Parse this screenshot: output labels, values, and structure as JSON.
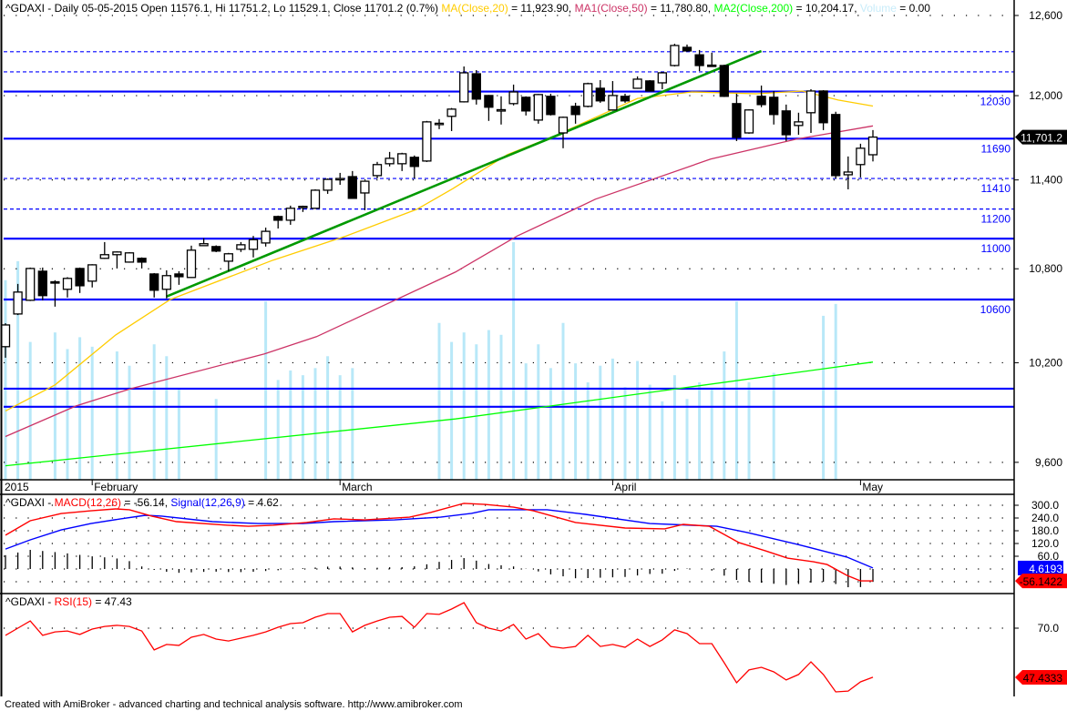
{
  "header": {
    "prefix": "^GDAXI - Daily 05-05-2015 Open 11576.1, Hi 11751.2, Lo 11529.1, Close 11701.2 (0.7%) ",
    "ma20_label": "MA(Close,20)",
    "ma20_value": " = 11,923.90, ",
    "ma50_label": "MA1(Close,50)",
    "ma50_value": " = 11,780.80, ",
    "ma200_label": "MA2(Close,200)",
    "ma200_value": " = 10,204.17, ",
    "volume_label": "Volume",
    "volume_value": " = 0.00"
  },
  "macd_header": {
    "prefix": "^GDAXI - ",
    "macd_label": "MACD(12,26)",
    "macd_value": " = -56.14, ",
    "signal_label": "Signal(12,26,9)",
    "signal_value": " = 4.62"
  },
  "rsi_header": {
    "prefix": "^GDAXI - ",
    "rsi_label": "RSI(15)",
    "rsi_value": " = 47.43"
  },
  "footer": "Created with AmiBroker - advanced charting and technical analysis software. http://www.amibroker.com",
  "colors": {
    "ma20": "#ffcc00",
    "ma50": "#cc3366",
    "ma200": "#00ff00",
    "volume": "#b8e8f8",
    "hline": "#0000ff",
    "trendline": "#009900",
    "macd": "#ff0000",
    "signal": "#0000ff",
    "rsi": "#ff0000"
  },
  "chart_data": [
    {
      "type": "candlestick",
      "title": "^GDAXI - Daily",
      "scale": "log",
      "ylim": [
        9600,
        12600
      ],
      "y_ticks": [
        {
          "v": 12600,
          "label": "12,600"
        },
        {
          "v": 12000,
          "label": "12,000"
        },
        {
          "v": 11400,
          "label": "11,400"
        },
        {
          "v": 10800,
          "label": "10,800"
        },
        {
          "v": 10200,
          "label": "10,200"
        },
        {
          "v": 9600,
          "label": "9,600"
        }
      ],
      "x_labels": [
        {
          "bar": 0,
          "label": "2015"
        },
        {
          "bar": 7,
          "label": "February"
        },
        {
          "bar": 27,
          "label": "March"
        },
        {
          "bar": 49,
          "label": "April"
        },
        {
          "bar": 69,
          "label": "May"
        }
      ],
      "last_price_label": "11,701.2",
      "ohlc": [
        [
          10300,
          10448,
          10231,
          10437
        ],
        [
          10507,
          10701,
          10500,
          10648
        ],
        [
          10595,
          10808,
          10590,
          10802
        ],
        [
          10784,
          10808,
          10595,
          10625
        ],
        [
          10715,
          10725,
          10554,
          10710
        ],
        [
          10666,
          10745,
          10613,
          10737
        ],
        [
          10802,
          10808,
          10642,
          10689
        ],
        [
          10719,
          10830,
          10678,
          10826
        ],
        [
          10869,
          10977,
          10865,
          10893
        ],
        [
          10893,
          10915,
          10802,
          10911
        ],
        [
          10844,
          10910,
          10840,
          10905
        ],
        [
          10869,
          10875,
          10802,
          10844
        ],
        [
          10766,
          10772,
          10613,
          10660
        ],
        [
          10666,
          10790,
          10607,
          10755
        ],
        [
          10766,
          10784,
          10695,
          10748
        ],
        [
          10743,
          10953,
          10740,
          10923
        ],
        [
          10953,
          11003,
          10950,
          10966
        ],
        [
          10947,
          10955,
          10910,
          10917
        ],
        [
          10850,
          10905,
          10784,
          10899
        ],
        [
          10929,
          10977,
          10911,
          10959
        ],
        [
          10929,
          11018,
          10875,
          10993
        ],
        [
          10971,
          11074,
          10947,
          11049
        ],
        [
          11149,
          11155,
          11068,
          11124
        ],
        [
          11124,
          11223,
          11093,
          11205
        ],
        [
          11212,
          11223,
          11180,
          11218
        ],
        [
          11205,
          11335,
          11200,
          11329
        ],
        [
          11329,
          11410,
          11304,
          11404
        ],
        [
          11404,
          11449,
          11366,
          11410
        ],
        [
          11423,
          11462,
          11270,
          11273
        ],
        [
          11310,
          11395,
          11192,
          11391
        ],
        [
          11430,
          11526,
          11410,
          11507
        ],
        [
          11513,
          11596,
          11494,
          11551
        ],
        [
          11513,
          11590,
          11462,
          11583
        ],
        [
          11558,
          11571,
          11410,
          11494
        ],
        [
          11532,
          11817,
          11525,
          11810
        ],
        [
          11795,
          11830,
          11758,
          11800
        ],
        [
          11850,
          11910,
          11744,
          11902
        ],
        [
          11955,
          12215,
          11950,
          12168
        ],
        [
          12161,
          12188,
          11935,
          11975
        ],
        [
          12001,
          12005,
          11817,
          11916
        ],
        [
          11890,
          11995,
          11791,
          11898
        ],
        [
          11942,
          12081,
          11929,
          12027
        ],
        [
          11988,
          11995,
          11856,
          11889
        ],
        [
          11823,
          12012,
          11797,
          12008
        ],
        [
          11995,
          12014,
          11856,
          11863
        ],
        [
          11731,
          11848,
          11622,
          11843
        ],
        [
          11922,
          11948,
          11797,
          11863
        ],
        [
          11922,
          12095,
          11915,
          12088
        ],
        [
          12054,
          12114,
          11948,
          11962
        ],
        [
          11896,
          12107,
          11890,
          12001
        ],
        [
          11995,
          12014,
          11948,
          11962
        ],
        [
          12054,
          12141,
          12050,
          12121
        ],
        [
          12108,
          12114,
          12030,
          12034
        ],
        [
          12094,
          12175,
          12047,
          12168
        ],
        [
          12222,
          12385,
          12215,
          12372
        ],
        [
          12358,
          12379,
          12325,
          12331
        ],
        [
          12302,
          12338,
          12181,
          12222
        ],
        [
          12225,
          12318,
          12218,
          12222
        ],
        [
          12222,
          12228,
          11990,
          11995
        ],
        [
          11942,
          12014,
          11673,
          11699
        ],
        [
          11731,
          11900,
          11725,
          11896
        ],
        [
          11995,
          12074,
          11916,
          11935
        ],
        [
          11988,
          12034,
          11791,
          11863
        ],
        [
          11889,
          11935,
          11673,
          11718
        ],
        [
          11784,
          11876,
          11718,
          11810
        ],
        [
          11876,
          12047,
          11731,
          12034
        ],
        [
          12034,
          12040,
          11751,
          11804
        ],
        [
          11863,
          11883,
          11410,
          11430
        ],
        [
          11436,
          11564,
          11335,
          11455
        ],
        [
          11507,
          11654,
          11417,
          11622
        ],
        [
          11576.1,
          11751.2,
          11529.1,
          11701.2
        ]
      ],
      "volume_relative": [
        84,
        92,
        58,
        null,
        62,
        55,
        60,
        56,
        null,
        54,
        48,
        null,
        57,
        52,
        38,
        null,
        null,
        34,
        null,
        null,
        null,
        75,
        42,
        46,
        44,
        47,
        52,
        44,
        47,
        null,
        null,
        null,
        null,
        null,
        null,
        66,
        58,
        62,
        57,
        63,
        61,
        100,
        49,
        57,
        47,
        66,
        49,
        41,
        48,
        51,
        39,
        50,
        40,
        33,
        44,
        34,
        41,
        38,
        54,
        75,
        41,
        null,
        45,
        null,
        null,
        null,
        69,
        74,
        null,
        null,
        null
      ],
      "ma20": [
        [
          0,
          9905
        ],
        [
          4,
          10063
        ],
        [
          8.9,
          10374
        ],
        [
          13.3,
          10600
        ],
        [
          21.6,
          10857
        ],
        [
          27.5,
          11018
        ],
        [
          33.2,
          11198
        ],
        [
          36.1,
          11340
        ],
        [
          40.5,
          11577
        ],
        [
          44.2,
          11705
        ],
        [
          51,
          11980
        ],
        [
          55.4,
          12027
        ],
        [
          60.6,
          12014
        ],
        [
          64.3,
          12034
        ],
        [
          67.2,
          11968
        ],
        [
          70,
          11924
        ]
      ],
      "ma50": [
        [
          0,
          9752
        ],
        [
          5.7,
          9935
        ],
        [
          10.1,
          10040
        ],
        [
          20.9,
          10255
        ],
        [
          25.1,
          10363
        ],
        [
          36.3,
          10778
        ],
        [
          41.3,
          11018
        ],
        [
          45.9,
          11198
        ],
        [
          47.6,
          11267
        ],
        [
          56.9,
          11545
        ],
        [
          63.8,
          11686
        ],
        [
          70,
          11781
        ]
      ],
      "ma200": [
        [
          0,
          9580
        ],
        [
          36.3,
          9857
        ],
        [
          54.2,
          10040
        ],
        [
          70,
          10204
        ]
      ],
      "trendline": [
        [
          13,
          10619
        ],
        [
          61,
          12330
        ]
      ],
      "horizontal_lines": [
        {
          "v": 12325,
          "style": "dashed",
          "label": ""
        },
        {
          "v": 12175,
          "style": "dashed",
          "label": ""
        },
        {
          "v": 12030,
          "style": "solid",
          "label": "12030"
        },
        {
          "v": 11690,
          "style": "solid",
          "label": "11690"
        },
        {
          "v": 11410,
          "style": "dashed",
          "label": "11410"
        },
        {
          "v": 11200,
          "style": "dashed",
          "label": "11200"
        },
        {
          "v": 11000,
          "style": "solid",
          "label": "11000"
        },
        {
          "v": 10600,
          "style": "solid",
          "label": "10600"
        },
        {
          "v": 10040,
          "style": "solid",
          "label": ""
        },
        {
          "v": 9930,
          "style": "solid",
          "label": ""
        }
      ]
    },
    {
      "type": "line",
      "title": "MACD(12,26) / Signal(12,26,9)",
      "y_ticks": [
        {
          "v": 300,
          "label": "300.0"
        },
        {
          "v": 240,
          "label": "240.0"
        },
        {
          "v": 180,
          "label": "180.0"
        },
        {
          "v": 120,
          "label": "120.0"
        },
        {
          "v": 60,
          "label": "60.0"
        }
      ],
      "grid": [
        300,
        240,
        180,
        120,
        60,
        0,
        -60
      ],
      "signal_last_label": "4.6193",
      "macd_last_label": "-56.1422",
      "macd": [
        [
          0,
          159
        ],
        [
          2,
          227
        ],
        [
          4.5,
          261
        ],
        [
          6.9,
          274
        ],
        [
          8.9,
          283
        ],
        [
          10,
          279
        ],
        [
          11.8,
          249
        ],
        [
          13.8,
          223
        ],
        [
          17.9,
          206
        ],
        [
          19.6,
          201
        ],
        [
          21.6,
          206
        ],
        [
          24.3,
          219
        ],
        [
          26.5,
          236
        ],
        [
          29,
          231
        ],
        [
          32.6,
          244
        ],
        [
          34.3,
          266
        ],
        [
          37,
          309
        ],
        [
          38.7,
          304
        ],
        [
          41,
          291
        ],
        [
          42.6,
          274
        ],
        [
          46,
          219
        ],
        [
          50,
          193
        ],
        [
          53.2,
          189
        ],
        [
          54.7,
          210
        ],
        [
          56.8,
          201
        ],
        [
          59.2,
          124
        ],
        [
          61.3,
          86
        ],
        [
          63.1,
          51
        ],
        [
          65.2,
          34
        ],
        [
          66.3,
          21
        ],
        [
          67.9,
          -30
        ],
        [
          69,
          -56
        ],
        [
          70,
          -56.14
        ]
      ],
      "signal": [
        [
          0,
          94
        ],
        [
          2,
          137
        ],
        [
          4.5,
          184
        ],
        [
          6.9,
          214
        ],
        [
          9.3,
          236
        ],
        [
          11.3,
          253
        ],
        [
          12.6,
          249
        ],
        [
          16.7,
          223
        ],
        [
          20.4,
          214
        ],
        [
          24,
          214
        ],
        [
          26.5,
          223
        ],
        [
          31.4,
          231
        ],
        [
          35.1,
          244
        ],
        [
          37.6,
          262
        ],
        [
          39,
          279
        ],
        [
          43.7,
          279
        ],
        [
          46.8,
          257
        ],
        [
          52,
          214
        ],
        [
          57.4,
          201
        ],
        [
          59.9,
          171
        ],
        [
          63.9,
          116
        ],
        [
          67.9,
          56
        ],
        [
          70,
          4.62
        ]
      ]
    },
    {
      "type": "line",
      "title": "RSI(15)",
      "y_ticks": [
        {
          "v": 70,
          "label": "70.0"
        }
      ],
      "last_label": "47.4333",
      "rsi": [
        66.7,
        70,
        73.3,
        66.7,
        68.3,
        68.7,
        67.1,
        69.6,
        70.8,
        71.3,
        70.8,
        68.7,
        60,
        62.5,
        62.1,
        65.8,
        67.1,
        65,
        64.1,
        65.4,
        66.7,
        68.3,
        70.4,
        72.1,
        72.5,
        75,
        76.7,
        76.7,
        68.3,
        71.3,
        73.3,
        75,
        75.4,
        70.4,
        76.7,
        76.3,
        78.8,
        81.7,
        72.5,
        70,
        68.7,
        71.7,
        65,
        67.5,
        61.6,
        60.8,
        61.6,
        66.7,
        61.6,
        62.5,
        61.2,
        65,
        61.6,
        64.6,
        69.2,
        67.5,
        62.9,
        62.9,
        54.1,
        44.9,
        50.8,
        52,
        49.9,
        46.2,
        48.7,
        54.5,
        48.7,
        40.7,
        41.1,
        45.3,
        47.43
      ]
    }
  ]
}
